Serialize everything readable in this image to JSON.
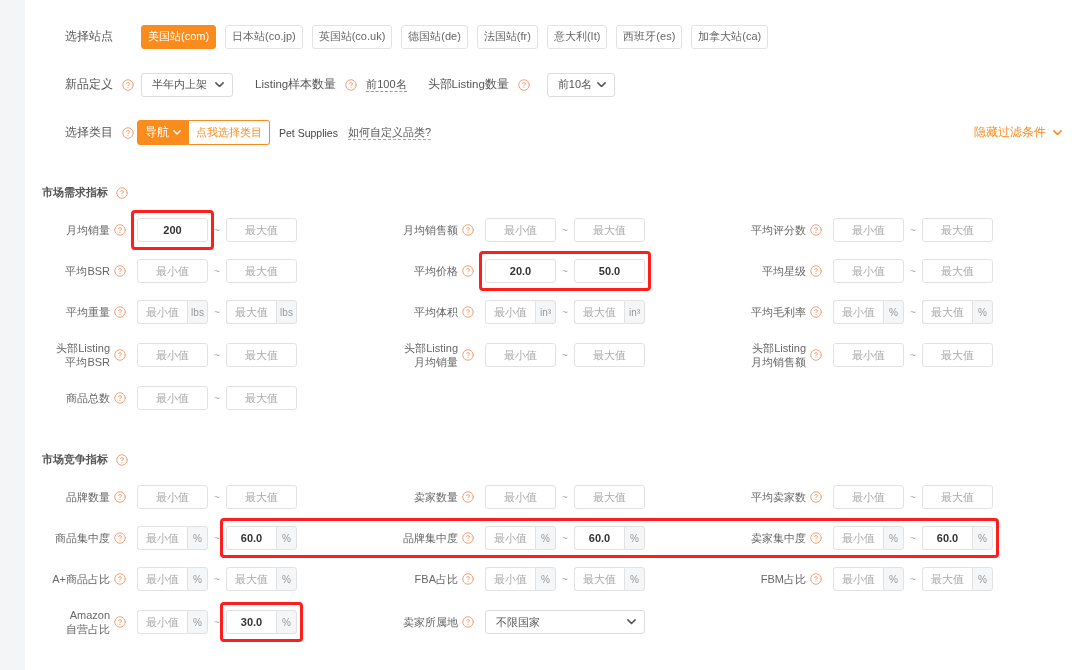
{
  "sites": {
    "label": "选择站点",
    "options": [
      {
        "label": "美国站(com)",
        "selected": true
      },
      {
        "label": "日本站(co.jp)",
        "selected": false
      },
      {
        "label": "英国站(co.uk)",
        "selected": false
      },
      {
        "label": "德国站(de)",
        "selected": false
      },
      {
        "label": "法国站(fr)",
        "selected": false
      },
      {
        "label": "意大利(It)",
        "selected": false
      },
      {
        "label": "西班牙(es)",
        "selected": false
      },
      {
        "label": "加拿大站(ca)",
        "selected": false
      }
    ]
  },
  "settings": {
    "new_product": {
      "label": "新品定义",
      "value": "半年内上架"
    },
    "sample_size": {
      "label": "Listing样本数量",
      "value": "前100名"
    },
    "top_listings": {
      "label": "头部Listing数量",
      "value": "前10名"
    }
  },
  "category": {
    "label": "选择类目",
    "nav_button": "导航",
    "pick_button": "点我选择类目",
    "current": "Pet Supplies",
    "help_link": "如何自定义品类?"
  },
  "toggle_filters": "隐藏过滤条件",
  "sections": [
    {
      "title": "市场需求指标",
      "filters": [
        {
          "kind": "range",
          "label": "月均销量",
          "separator": "~",
          "min": {
            "value": "200",
            "highlighted": true
          },
          "max": {
            "placeholder": "最大值",
            "highlighted": false
          }
        },
        {
          "kind": "range",
          "label": "月均销售额",
          "separator": "~",
          "min": {
            "placeholder": "最小值",
            "highlighted": false
          },
          "max": {
            "placeholder": "最大值",
            "highlighted": false
          }
        },
        {
          "kind": "range",
          "label": "平均评分数",
          "separator": "~",
          "min": {
            "placeholder": "最小值",
            "highlighted": false
          },
          "max": {
            "placeholder": "最大值",
            "highlighted": false
          }
        },
        {
          "kind": "range",
          "label": "平均BSR",
          "separator": "~",
          "min": {
            "placeholder": "最小值",
            "highlighted": false
          },
          "max": {
            "placeholder": "最大值",
            "highlighted": false
          }
        },
        {
          "kind": "range",
          "label": "平均价格",
          "separator": "~",
          "min": {
            "value": "20.0",
            "highlighted": true
          },
          "max": {
            "value": "50.0",
            "highlighted": true
          }
        },
        {
          "kind": "range",
          "label": "平均星级",
          "separator": "~",
          "min": {
            "placeholder": "最小值",
            "highlighted": false
          },
          "max": {
            "placeholder": "最大值",
            "highlighted": false
          }
        },
        {
          "kind": "range",
          "label": "平均重量",
          "separator": "~",
          "min": {
            "placeholder": "最小值",
            "unit": "lbs",
            "highlighted": false
          },
          "max": {
            "placeholder": "最大值",
            "unit": "lbs",
            "highlighted": false
          }
        },
        {
          "kind": "range",
          "label": "平均体积",
          "separator": "~",
          "min": {
            "placeholder": "最小值",
            "unit": "in³",
            "highlighted": false
          },
          "max": {
            "placeholder": "最大值",
            "unit": "in³",
            "highlighted": false
          }
        },
        {
          "kind": "range",
          "label": "平均毛利率",
          "separator": "~",
          "min": {
            "placeholder": "最小值",
            "unit": "%",
            "highlighted": false
          },
          "max": {
            "placeholder": "最大值",
            "unit": "%",
            "highlighted": false
          }
        },
        {
          "kind": "range",
          "label": "头部Listing\n平均BSR",
          "separator": "~",
          "min": {
            "placeholder": "最小值",
            "highlighted": false
          },
          "max": {
            "placeholder": "最大值",
            "highlighted": false
          }
        },
        {
          "kind": "range",
          "label": "头部Listing\n月均销量",
          "separator": "~",
          "min": {
            "placeholder": "最小值",
            "highlighted": false
          },
          "max": {
            "placeholder": "最大值",
            "highlighted": false
          }
        },
        {
          "kind": "range",
          "label": "头部Listing\n月均销售额",
          "separator": "~",
          "min": {
            "placeholder": "最小值",
            "highlighted": false
          },
          "max": {
            "placeholder": "最大值",
            "highlighted": false
          }
        },
        {
          "kind": "range",
          "label": "商品总数",
          "separator": "~",
          "min": {
            "placeholder": "最小值",
            "highlighted": false
          },
          "max": {
            "placeholder": "最大值",
            "highlighted": false
          }
        }
      ]
    },
    {
      "title": "市场竞争指标",
      "filters": [
        {
          "kind": "range",
          "label": "品牌数量",
          "separator": "~",
          "min": {
            "placeholder": "最小值",
            "highlighted": false
          },
          "max": {
            "placeholder": "最大值",
            "highlighted": false
          }
        },
        {
          "kind": "range",
          "label": "卖家数量",
          "separator": "~",
          "min": {
            "placeholder": "最小值",
            "highlighted": false
          },
          "max": {
            "placeholder": "最大值",
            "highlighted": false
          }
        },
        {
          "kind": "range",
          "label": "平均卖家数",
          "separator": "~",
          "min": {
            "placeholder": "最小值",
            "highlighted": false
          },
          "max": {
            "placeholder": "最大值",
            "highlighted": false
          }
        },
        {
          "kind": "range",
          "label": "商品集中度",
          "separator": "~",
          "min": {
            "placeholder": "最小值",
            "unit": "%",
            "highlighted": false
          },
          "max": {
            "value": "60.0",
            "unit": "%",
            "highlighted": true
          }
        },
        {
          "kind": "range",
          "label": "品牌集中度",
          "separator": "~",
          "min": {
            "placeholder": "最小值",
            "unit": "%",
            "highlighted": true
          },
          "max": {
            "value": "60.0",
            "unit": "%",
            "highlighted": true
          }
        },
        {
          "kind": "range",
          "label": "卖家集中度",
          "separator": "~",
          "min": {
            "placeholder": "最小值",
            "unit": "%",
            "highlighted": true
          },
          "max": {
            "value": "60.0",
            "unit": "%",
            "highlighted": true
          }
        },
        {
          "kind": "range",
          "label": "A+商品占比",
          "separator": "~",
          "min": {
            "placeholder": "最小值",
            "unit": "%",
            "highlighted": false
          },
          "max": {
            "placeholder": "最大值",
            "unit": "%",
            "highlighted": false
          }
        },
        {
          "kind": "range",
          "label": "FBA占比",
          "separator": "~",
          "min": {
            "placeholder": "最小值",
            "unit": "%",
            "highlighted": false
          },
          "max": {
            "placeholder": "最大值",
            "unit": "%",
            "highlighted": false
          }
        },
        {
          "kind": "range",
          "label": "FBM占比",
          "separator": "~",
          "min": {
            "placeholder": "最小值",
            "unit": "%",
            "highlighted": false
          },
          "max": {
            "placeholder": "最大值",
            "unit": "%",
            "highlighted": false
          }
        },
        {
          "kind": "range",
          "label": "Amazon\n自营占比",
          "separator": "~",
          "min": {
            "placeholder": "最小值",
            "unit": "%",
            "highlighted": false
          },
          "max": {
            "value": "30.0",
            "unit": "%",
            "highlighted": true
          }
        },
        {
          "kind": "select",
          "label": "卖家所属地",
          "value": "不限国家"
        }
      ]
    }
  ]
}
